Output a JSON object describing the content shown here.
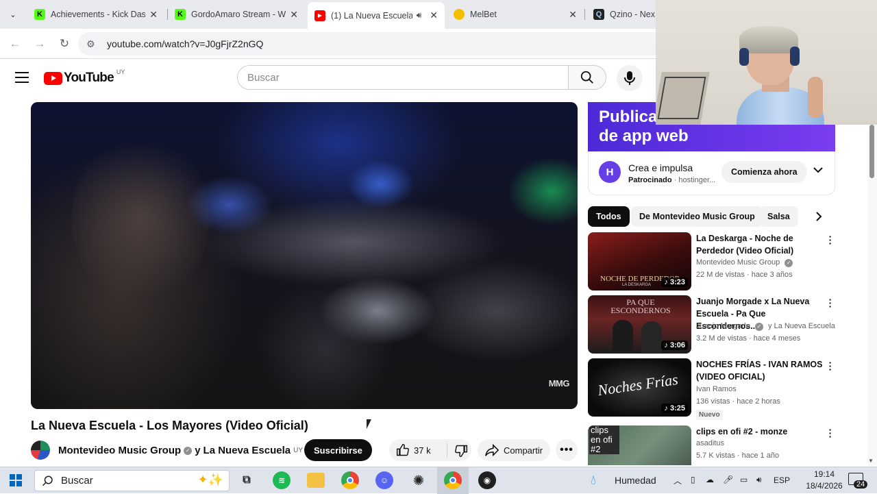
{
  "browser": {
    "tabs": [
      {
        "title": "Achievements - Kick Dash",
        "favicon_color": "#53fc18",
        "favicon_glyph": "K"
      },
      {
        "title": "GordoAmaro Stream - W",
        "favicon_color": "#53fc18",
        "favicon_glyph": "K"
      },
      {
        "title": "(1) La Nueva Escuela",
        "favicon_color": "#ff0000",
        "favicon_glyph": "▶",
        "active": true
      },
      {
        "title": "MelBet",
        "favicon_color": "#f5c000",
        "favicon_glyph": "◐"
      },
      {
        "title": "Qzino - Next-",
        "favicon_color": "#222222",
        "favicon_glyph": "Q"
      }
    ],
    "url": "youtube.com/watch?v=J0gFjrZ2nGQ"
  },
  "yt": {
    "logo_text": "YouTube",
    "country": "UY",
    "search_placeholder": "Buscar"
  },
  "video": {
    "watermark": "MMG",
    "title": "La Nueva Escuela - Los Mayores (Video Oficial)",
    "channel": "Montevideo Music Group",
    "collab_prefix": "y",
    "collab": "La Nueva Escuela",
    "collab_country": "UY",
    "subscribe_label": "Suscribirse",
    "likes": "37 k",
    "share_label": "Compartir"
  },
  "ad": {
    "banner_line1": "Publica",
    "banner_line2": "de app web",
    "title": "Crea e impulsa",
    "sponsored": "Patrocinado",
    "advertiser": "hostinger...",
    "cta": "Comienza ahora"
  },
  "chips": [
    "Todos",
    "De Montevideo Music Group",
    "Salsa"
  ],
  "recommendations": [
    {
      "title": "La Deskarga -  Noche de Perdedor (Video Oficial)",
      "channel": "Montevideo Music Group",
      "verified": true,
      "stats": "22 M de vistas · hace 3 años",
      "duration": "3:23",
      "thumb_text": "NOCHE DE PERDEDOR",
      "thumb_sub": "LA DESKARGA"
    },
    {
      "title": "Juanjo Morgade x La Nueva Escuela - Pa Que Escondernos...",
      "channel": "Juanjo Morgade",
      "verified": true,
      "channel_extra": "y La Nueva Escuela ...",
      "stats": "3.2 M de vistas · hace 4 meses",
      "duration": "3:06",
      "thumb_text": "PA QUE ESCONDERNOS"
    },
    {
      "title": "NOCHES FRÍAS - IVAN RAMOS (VIDEO OFICIAL)",
      "channel": "Ivan Ramos",
      "verified": false,
      "stats": "136 vistas · hace 2 horas",
      "badge": "Nuevo",
      "duration": "3:25",
      "thumb_text": "Noches Frías"
    },
    {
      "title": "clips en ofi #2 - monze",
      "channel": "asaditus",
      "verified": false,
      "stats": "5.7 K vistas · hace 1 año",
      "thumb_text": "clips en ofi #2"
    }
  ],
  "taskbar": {
    "search_placeholder": "Buscar",
    "weather": "Humedad",
    "lang": "ESP",
    "time": "19:14",
    "date": "18/4/2026",
    "notifications": "24"
  }
}
